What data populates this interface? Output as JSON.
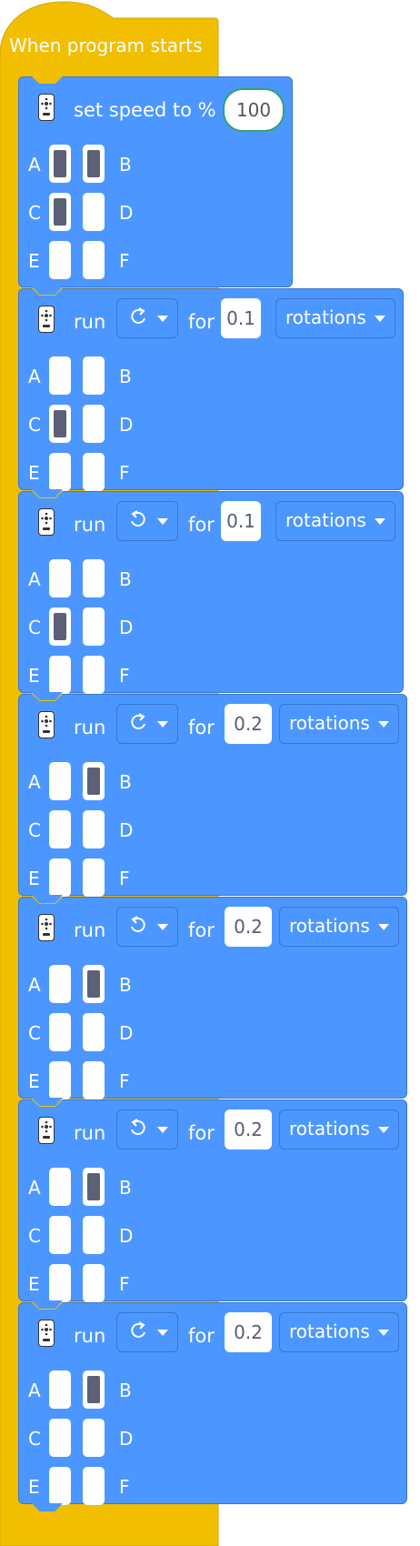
{
  "hat": {
    "label": "When program starts",
    "color": "#f2be00"
  },
  "colors": {
    "block": "#4c97ff",
    "block_border": "#3a76cc",
    "port_active": "#5d6175"
  },
  "speed_block": {
    "label": "set speed to %",
    "value": "100",
    "icon": "hub-icon",
    "ports": {
      "A": true,
      "B": true,
      "C": true,
      "D": false,
      "E": false,
      "F": false
    }
  },
  "port_letters": [
    "A",
    "B",
    "C",
    "D",
    "E",
    "F"
  ],
  "run_blocks": [
    {
      "run_label": "run",
      "direction": "clockwise",
      "for_label": "for",
      "amount": "0.1",
      "unit": "rotations",
      "ports": {
        "A": false,
        "B": false,
        "C": true,
        "D": false,
        "E": false,
        "F": false
      }
    },
    {
      "run_label": "run",
      "direction": "counterclockwise",
      "for_label": "for",
      "amount": "0.1",
      "unit": "rotations",
      "ports": {
        "A": false,
        "B": false,
        "C": true,
        "D": false,
        "E": false,
        "F": false
      }
    },
    {
      "run_label": "run",
      "direction": "clockwise",
      "for_label": "for",
      "amount": "0.2",
      "unit": "rotations",
      "ports": {
        "A": false,
        "B": true,
        "C": false,
        "D": false,
        "E": false,
        "F": false
      }
    },
    {
      "run_label": "run",
      "direction": "counterclockwise",
      "for_label": "for",
      "amount": "0.2",
      "unit": "rotations",
      "ports": {
        "A": false,
        "B": true,
        "C": false,
        "D": false,
        "E": false,
        "F": false
      }
    },
    {
      "run_label": "run",
      "direction": "counterclockwise",
      "for_label": "for",
      "amount": "0.2",
      "unit": "rotations",
      "ports": {
        "A": false,
        "B": true,
        "C": false,
        "D": false,
        "E": false,
        "F": false
      }
    },
    {
      "run_label": "run",
      "direction": "clockwise",
      "for_label": "for",
      "amount": "0.2",
      "unit": "rotations",
      "ports": {
        "A": false,
        "B": true,
        "C": false,
        "D": false,
        "E": false,
        "F": false
      }
    }
  ]
}
